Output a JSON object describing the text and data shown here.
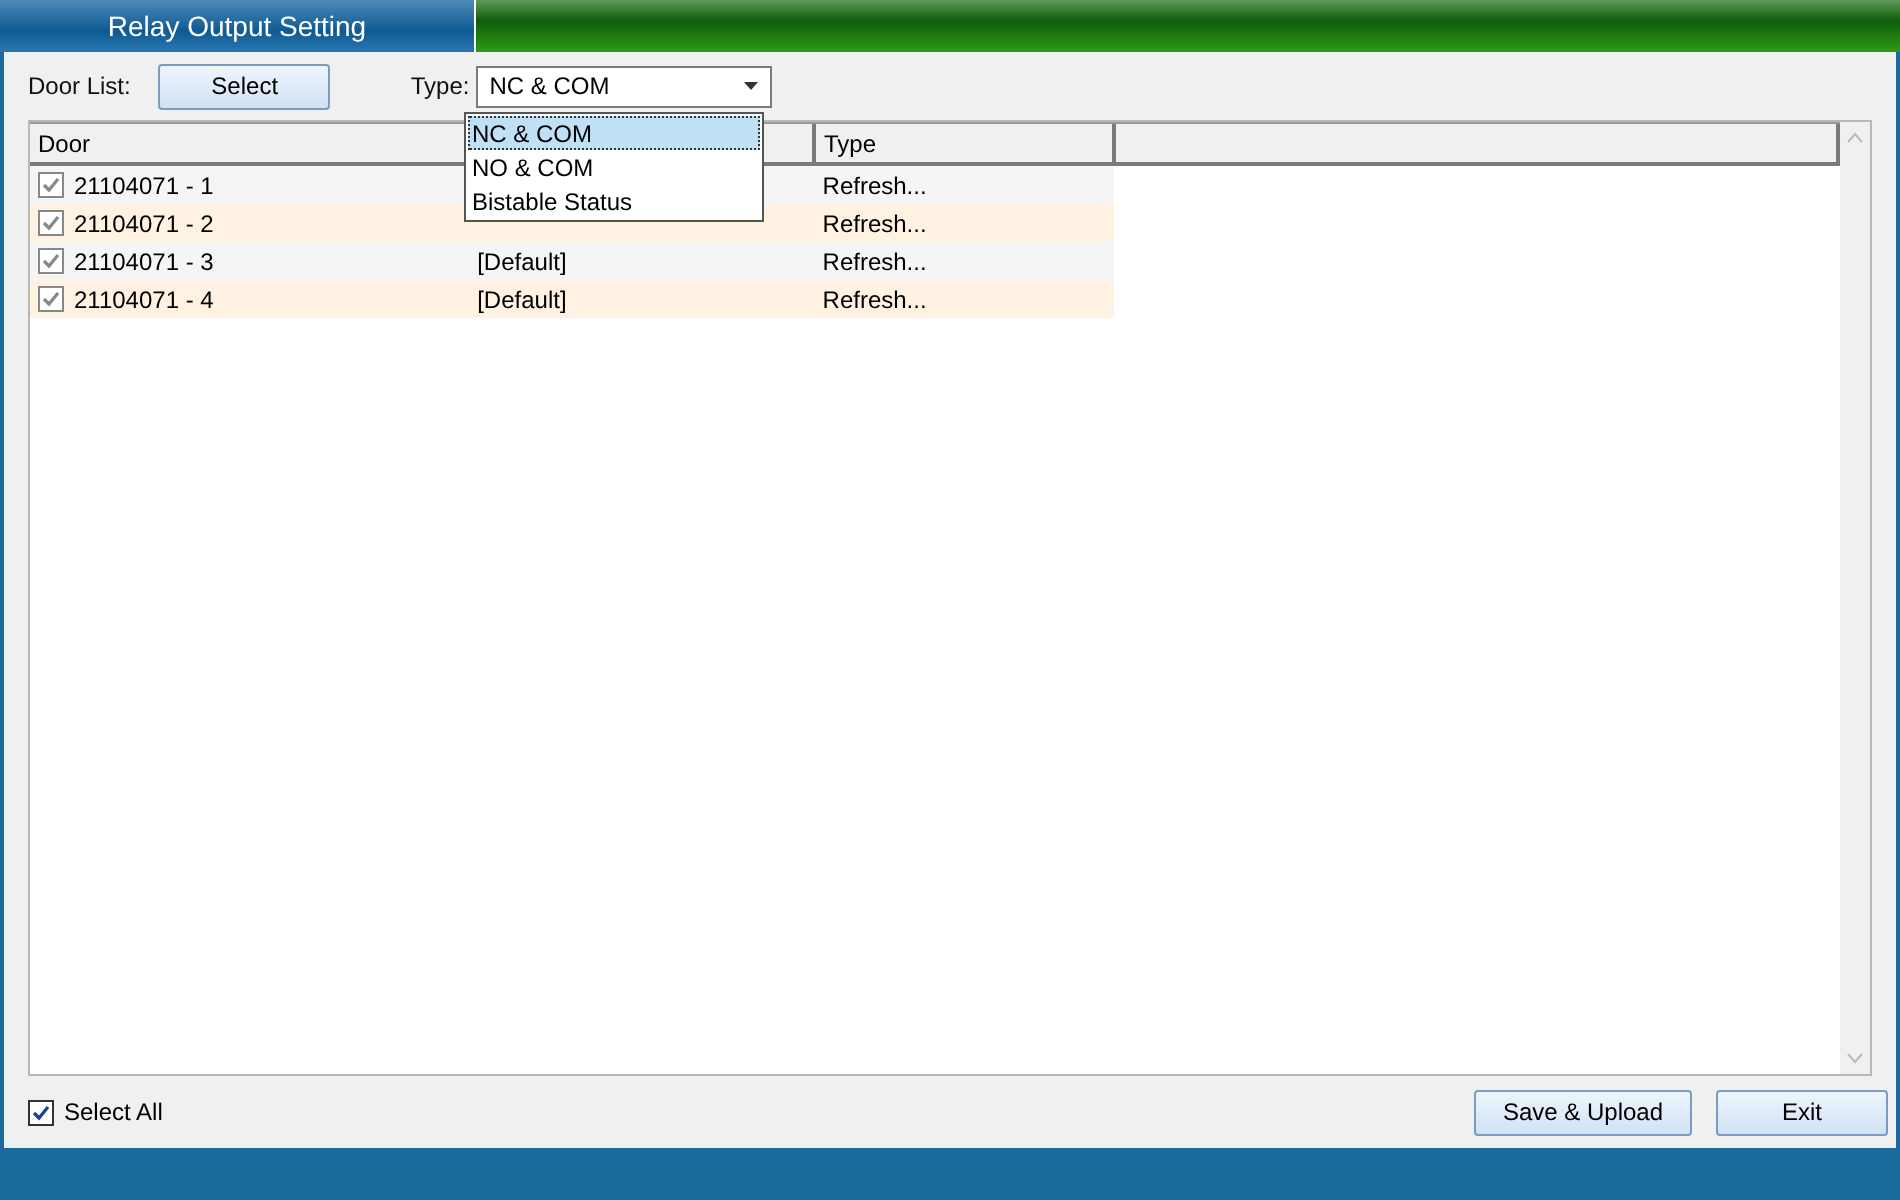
{
  "window": {
    "title": "Relay Output Setting"
  },
  "toolbar": {
    "door_list_label": "Door List:",
    "select_button": "Select",
    "type_label": "Type:",
    "type_value": "NC & COM"
  },
  "dropdown": [
    {
      "label": "NC & COM",
      "selected": true
    },
    {
      "label": "NO & COM",
      "selected": false
    },
    {
      "label": "Bistable Status",
      "selected": false
    }
  ],
  "table": {
    "columns": [
      "Door",
      "Type"
    ],
    "rows": [
      {
        "checked": true,
        "door": "21104071 - 1",
        "type": "Refresh..."
      },
      {
        "checked": true,
        "door": "21104071 - 2",
        "type": "Refresh..."
      },
      {
        "checked": true,
        "door": "21104071 - 3",
        "column_2": "[Default]",
        "type": "Refresh..."
      },
      {
        "checked": true,
        "door": "21104071 - 4",
        "column_2": "[Default]",
        "type": "Refresh..."
      }
    ]
  },
  "select_all": {
    "label": "Select All",
    "checked": true
  },
  "buttons": [
    "Save & Upload",
    "Exit"
  ]
}
